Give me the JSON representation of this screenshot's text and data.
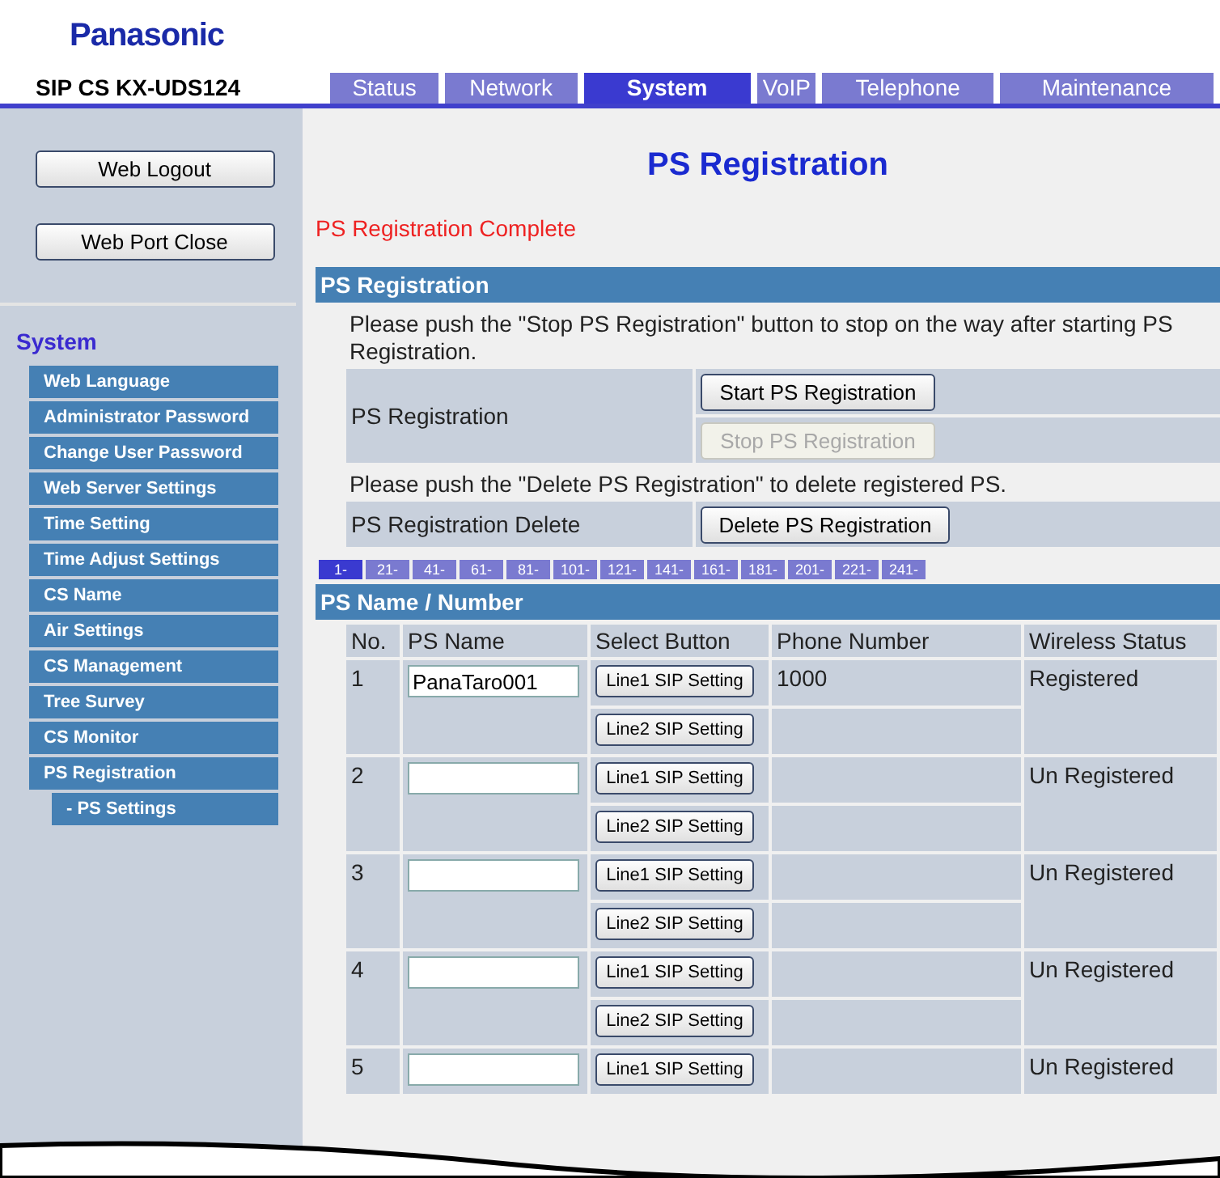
{
  "header": {
    "logo": "Panasonic",
    "model": "SIP CS KX-UDS124",
    "tabs": [
      {
        "label": "Status",
        "selected": false
      },
      {
        "label": "Network",
        "selected": false
      },
      {
        "label": "System",
        "selected": true
      },
      {
        "label": "VoIP",
        "selected": false
      },
      {
        "label": "Telephone",
        "selected": false
      },
      {
        "label": "Maintenance",
        "selected": false
      }
    ]
  },
  "sidebar": {
    "buttons": [
      "Web Logout",
      "Web Port Close"
    ],
    "section_title": "System",
    "items": [
      {
        "label": "Web Language"
      },
      {
        "label": "Administrator Password"
      },
      {
        "label": "Change User Password"
      },
      {
        "label": "Web Server Settings"
      },
      {
        "label": "Time Setting"
      },
      {
        "label": "Time Adjust Settings"
      },
      {
        "label": "CS Name"
      },
      {
        "label": "Air Settings"
      },
      {
        "label": "CS Management"
      },
      {
        "label": "Tree Survey"
      },
      {
        "label": "CS Monitor"
      },
      {
        "label": "PS Registration",
        "children": [
          {
            "label": "- PS Settings"
          }
        ]
      }
    ]
  },
  "main": {
    "title": "PS Registration",
    "message": "PS Registration Complete",
    "registration": {
      "header": "PS Registration",
      "note": "Please push the \"Stop PS Registration\" button to stop on the way after starting PS Registration.",
      "label": "PS Registration",
      "buttons": [
        {
          "label": "Start PS Registration",
          "disabled": false
        },
        {
          "label": "Stop PS Registration",
          "disabled": true
        }
      ],
      "delete_note": "Please push the \"Delete PS Registration\" to delete registered PS.",
      "delete_label": "PS Registration Delete",
      "delete_button": "Delete PS Registration"
    },
    "pages": [
      {
        "label": "1-",
        "selected": true
      },
      {
        "label": "21-",
        "selected": false
      },
      {
        "label": "41-",
        "selected": false
      },
      {
        "label": "61-",
        "selected": false
      },
      {
        "label": "81-",
        "selected": false
      },
      {
        "label": "101-",
        "selected": false
      },
      {
        "label": "121-",
        "selected": false
      },
      {
        "label": "141-",
        "selected": false
      },
      {
        "label": "161-",
        "selected": false
      },
      {
        "label": "181-",
        "selected": false
      },
      {
        "label": "201-",
        "selected": false
      },
      {
        "label": "221-",
        "selected": false
      },
      {
        "label": "241-",
        "selected": false
      }
    ],
    "ps_table": {
      "header": "PS Name / Number",
      "columns": [
        "No.",
        "PS Name",
        "Select Button",
        "Phone Number",
        "Wireless Status"
      ],
      "rows": [
        {
          "no": "1",
          "name": "PanaTaro001",
          "buttons": [
            "Line1 SIP Setting",
            "Line2 SIP Setting"
          ],
          "phone": "1000",
          "status": "Registered"
        },
        {
          "no": "2",
          "buttons": [
            "Line1 SIP Setting",
            "Line2 SIP Setting"
          ],
          "status": "Un Registered"
        },
        {
          "no": "3",
          "buttons": [
            "Line1 SIP Setting",
            "Line2 SIP Setting"
          ],
          "status": "Un Registered"
        },
        {
          "no": "4",
          "buttons": [
            "Line1 SIP Setting",
            "Line2 SIP Setting"
          ],
          "status": "Un Registered"
        },
        {
          "no": "5",
          "buttons": [
            "Line1 SIP Setting"
          ],
          "status": "Un Registered"
        }
      ]
    }
  }
}
